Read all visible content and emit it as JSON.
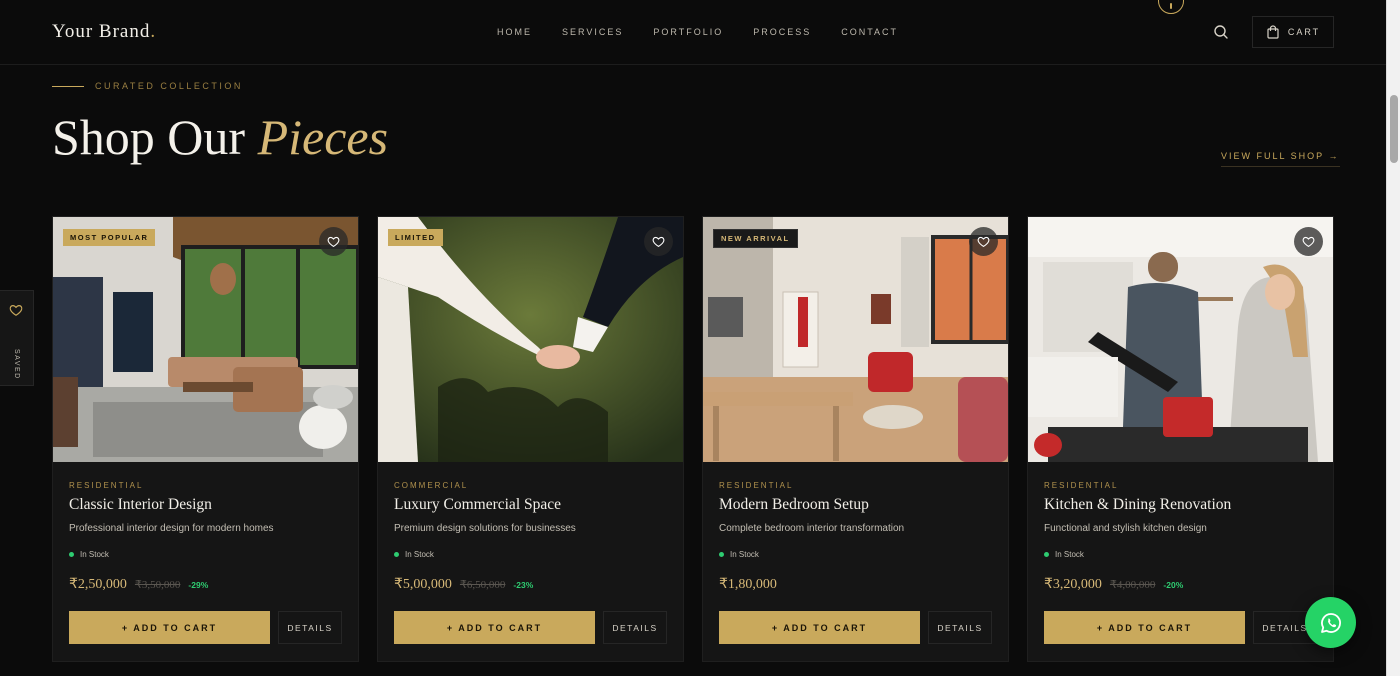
{
  "header": {
    "brand": "Your Brand",
    "brand_dot": ".",
    "nav": [
      "HOME",
      "SERVICES",
      "PORTFOLIO",
      "PROCESS",
      "CONTACT"
    ],
    "cart_label": "CART"
  },
  "saved": {
    "label": "SAVED"
  },
  "section": {
    "eyebrow": "CURATED COLLECTION",
    "title_main": "Shop Our",
    "title_accent": "Pieces",
    "view_all": "VIEW FULL SHOP →"
  },
  "products": [
    {
      "badge": "MOST POPULAR",
      "category": "RESIDENTIAL",
      "name": "Classic Interior Design",
      "description": "Professional interior design for modern homes",
      "stock": "In Stock",
      "price": "₹2,50,000",
      "old_price": "₹3,50,000",
      "discount": "-29%",
      "add_label": "+ ADD TO CART",
      "details_label": "DETAILS"
    },
    {
      "badge": "LIMITED",
      "category": "COMMERCIAL",
      "name": "Luxury Commercial Space",
      "description": "Premium design solutions for businesses",
      "stock": "In Stock",
      "price": "₹5,00,000",
      "old_price": "₹6,50,000",
      "discount": "-23%",
      "add_label": "+ ADD TO CART",
      "details_label": "DETAILS"
    },
    {
      "badge": "NEW ARRIVAL",
      "category": "RESIDENTIAL",
      "name": "Modern Bedroom Setup",
      "description": "Complete bedroom interior transformation",
      "stock": "In Stock",
      "price": "₹1,80,000",
      "old_price": "",
      "discount": "",
      "add_label": "+ ADD TO CART",
      "details_label": "DETAILS"
    },
    {
      "badge": "",
      "category": "RESIDENTIAL",
      "name": "Kitchen & Dining Renovation",
      "description": "Functional and stylish kitchen design",
      "stock": "In Stock",
      "price": "₹3,20,000",
      "old_price": "₹4,00,000",
      "discount": "-20%",
      "add_label": "+ ADD TO CART",
      "details_label": "DETAILS"
    }
  ],
  "icons": {
    "search": "search-icon",
    "cart": "shopping-bag-icon",
    "heart": "heart-icon",
    "whatsapp": "whatsapp-icon"
  },
  "colors": {
    "background": "#0b0b0b",
    "accent_gold": "#c9a95c",
    "stock_green": "#2ecc71",
    "whatsapp_green": "#25d366"
  }
}
